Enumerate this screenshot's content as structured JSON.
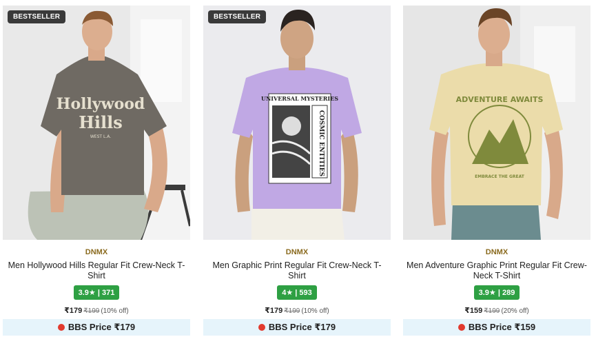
{
  "products": [
    {
      "badge": "BESTSELLER",
      "brand": "DNMX",
      "title": "Men Hollywood Hills Regular Fit Crew-Neck T-Shirt",
      "rating": "3.9",
      "star": "★",
      "reviews": "371",
      "price": "₹179",
      "mrp": "₹199",
      "discount": "(10% off)",
      "bbs_label": "BBS Price",
      "bbs_price": "₹179",
      "shirt_color": "#6f6a63",
      "print_text": "Hollywood Hills",
      "image_icon": "model-grey-tshirt"
    },
    {
      "badge": "BESTSELLER",
      "brand": "DNMX",
      "title": "Men Graphic Print Regular Fit Crew-Neck T-Shirt",
      "rating": "4",
      "star": "★",
      "reviews": "593",
      "price": "₹179",
      "mrp": "₹199",
      "discount": "(10% off)",
      "bbs_label": "BBS Price",
      "bbs_price": "₹179",
      "shirt_color": "#c0a8e4",
      "print_text": "UNIVERSAL MYSTERIES",
      "image_icon": "model-lavender-tshirt"
    },
    {
      "badge": "",
      "brand": "DNMX",
      "title": "Men Adventure Graphic Print Regular Fit Crew-Neck T-Shirt",
      "rating": "3.9",
      "star": "★",
      "reviews": "289",
      "price": "₹159",
      "mrp": "₹199",
      "discount": "(20% off)",
      "bbs_label": "BBS Price",
      "bbs_price": "₹159",
      "shirt_color": "#ebdcaa",
      "print_text": "ADVENTURE AWAITS",
      "image_icon": "model-beige-tshirt"
    }
  ]
}
